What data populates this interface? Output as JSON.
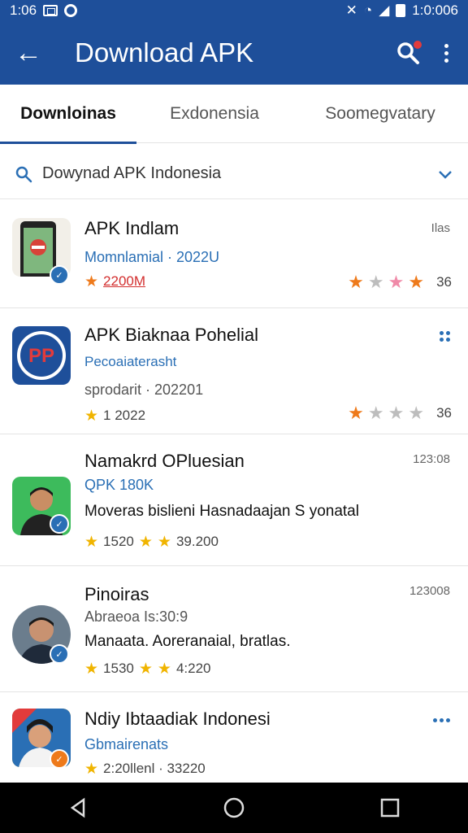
{
  "status_bar": {
    "time": "1:06",
    "right_text": "1:0:006"
  },
  "app_bar": {
    "title": "Download APK"
  },
  "tabs": [
    {
      "label": "Downloinas",
      "active": true
    },
    {
      "label": "Exdonensia",
      "active": false
    },
    {
      "label": "Soomegvatary",
      "active": false
    }
  ],
  "search": {
    "text": "Dowynad APK Indonesia"
  },
  "apps": [
    {
      "title": "APK Indlam",
      "subtitle": "Momnlamial · 2022U",
      "rating_text": "2200M",
      "meta": "Ilas",
      "score": "36"
    },
    {
      "title": "APK Biaknaa Pohelial",
      "subtitle": "Pecoaiaterasht",
      "line3": "sprodarit · 202201",
      "rating_text": "1 2022",
      "score": "36"
    },
    {
      "title": "Namakrd OPluesian",
      "subtitle": "QPK  180K",
      "description": "Moveras bislieni Hasnadaajan S yonatal",
      "rating_text": "1520",
      "rating_text2": "39.200",
      "meta": "123:08"
    },
    {
      "title": "Pinoiras",
      "subtitle": "Abraeoa Is:30:9",
      "description": "Manaata. Aoreranaial, bratlas.",
      "rating_text": "1530",
      "rating_text2": "4:220",
      "meta": "123008"
    },
    {
      "title": "Ndiy Ibtaadiak Indonesi",
      "subtitle": "Gbmairenats",
      "rating_text": "2:20llenl · 33220"
    }
  ],
  "colors": {
    "primary": "#1e4f9a",
    "link": "#2a6fb5",
    "star_gold": "#f0b400",
    "star_orange": "#ee7a1b"
  }
}
